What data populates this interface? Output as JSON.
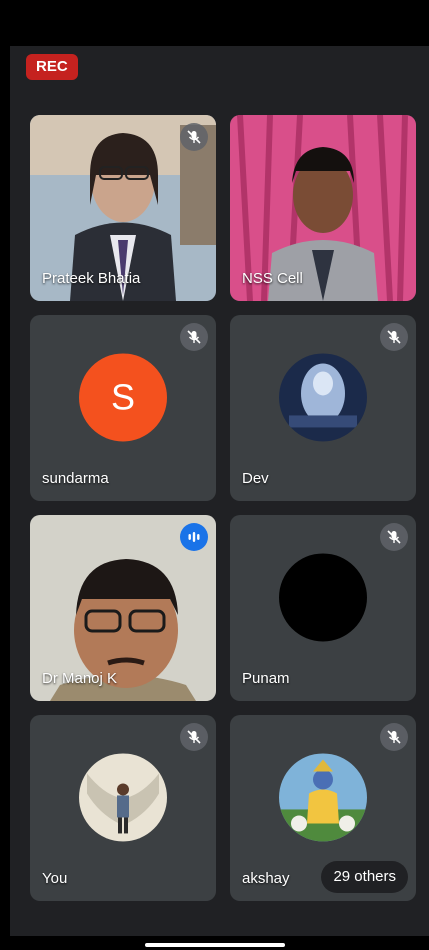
{
  "recording": {
    "label": "REC"
  },
  "participants": [
    {
      "name": "Prateek Bhatia",
      "mic": "muted"
    },
    {
      "name": "NSS Cell",
      "mic": "none"
    },
    {
      "name": "sundarma",
      "mic": "muted",
      "avatar_letter": "S",
      "avatar_color": "#f4511e"
    },
    {
      "name": "Dev",
      "mic": "muted"
    },
    {
      "name": "Dr Manoj K",
      "mic": "speaking"
    },
    {
      "name": "Punam",
      "mic": "muted"
    },
    {
      "name": "You",
      "mic": "muted"
    },
    {
      "name": "akshay",
      "mic": "muted"
    }
  ],
  "overflow": {
    "label": "29 others"
  },
  "colors": {
    "rec": "#c5221f",
    "speaking": "#1a73e8",
    "tile": "#3c4043",
    "background": "#202124"
  }
}
